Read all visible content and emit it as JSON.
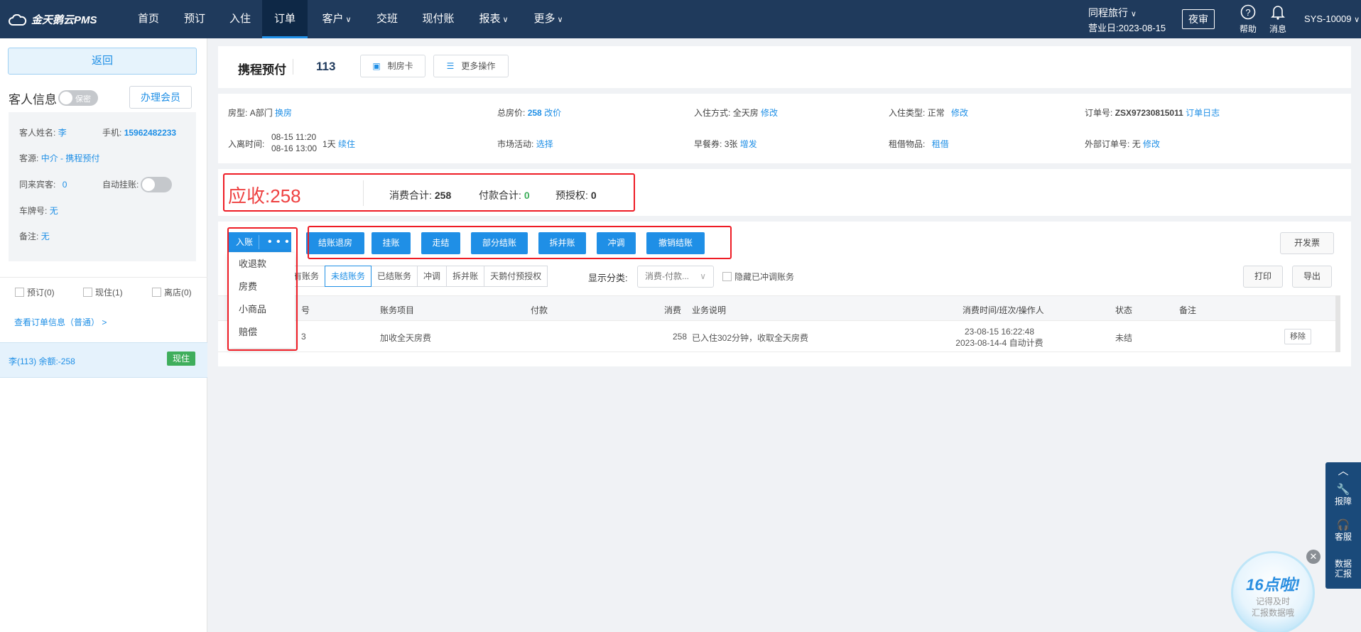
{
  "nav": {
    "logo": "金天鹅云PMS",
    "items": [
      "首页",
      "预订",
      "入住",
      "订单",
      "客户",
      "交班",
      "现付账",
      "报表",
      "更多"
    ],
    "active": "订单",
    "hotel": "同程旅行",
    "business_date_label": "营业日:",
    "business_date": "2023-08-15",
    "night_audit": "夜审",
    "help": "帮助",
    "messages": "消息",
    "user": "SYS-10009"
  },
  "left": {
    "back": "返回",
    "guest_title": "客人信息",
    "privacy_toggle": "保密",
    "member_button": "办理会员",
    "guest_name_label": "客人姓名:",
    "guest_name": "李",
    "phone_label": "手机:",
    "phone": "15962482233",
    "source_label": "客源:",
    "source": "中介",
    "source_detail": "- 携程预付",
    "companions_label": "同来宾客:",
    "companions": "0",
    "auto_hang_label": "自动挂账:",
    "plate_label": "车牌号:",
    "plate": "无",
    "remark_label": "备注:",
    "remark": "无",
    "checks": [
      "预订(0)",
      "现住(1)",
      "离店(0)"
    ],
    "order_info_link": "查看订单信息（普通） >",
    "room_row": "李(113)  余额:-258",
    "room_status": "现住"
  },
  "header": {
    "order_type": "携程预付",
    "room_no": "113",
    "make_card": "制房卡",
    "more_ops": "更多操作"
  },
  "details": {
    "room_type_label": "房型:",
    "room_type": "A部门",
    "change_room": "换房",
    "total_price_label": "总房价:",
    "total_price": "258",
    "change_price": "改价",
    "checkin_mode_label": "入住方式:",
    "checkin_mode": "全天房",
    "modify": "修改",
    "checkin_type_label": "入住类型:",
    "checkin_type": "正常",
    "order_no_label": "订单号:",
    "order_no": "ZSX97230815011",
    "order_log": "订单日志",
    "stay_label": "入离时间:",
    "arrive": "08-15 11:20",
    "depart": "08-16 13:00",
    "nights": "1天",
    "extend": "续住",
    "market_label": "市场活动:",
    "market": "选择",
    "breakfast_label": "早餐券:",
    "breakfast": "3张",
    "breakfast_add": "增发",
    "rental_label": "租借物品:",
    "rental": "租借",
    "ext_order_label": "外部订单号:",
    "ext_order": "无",
    "ext_modify": "修改"
  },
  "summary": {
    "due_label": "应收:",
    "due": "258",
    "consume_label": "消费合计:",
    "consume": "258",
    "payment_label": "付款合计:",
    "payment": "0",
    "preauth_label": "预授权:",
    "preauth": "0"
  },
  "billing": {
    "post": "入账",
    "more": "• • •",
    "actions": [
      "结账退房",
      "挂账",
      "走结",
      "部分结账",
      "拆并账",
      "冲调",
      "撤销结账"
    ],
    "invoice": "开发票",
    "filters": [
      "有账务",
      "未结账务",
      "已结账务",
      "冲调",
      "拆并账",
      "天鹅付预授权"
    ],
    "filter_active": "未结账务",
    "display_label": "显示分类:",
    "display_value": "消费-付款...",
    "hide_offset": "隐藏已冲调账务",
    "print": "打印",
    "export": "导出",
    "columns": [
      "号",
      "账务项目",
      "付款",
      "消费",
      "业务说明",
      "消费时间/班次/操作人",
      "状态",
      "备注"
    ],
    "rows": [
      {
        "no": "3",
        "item": "加收全天房费",
        "payment": "",
        "consume": "258",
        "desc": "已入住302分钟，收取全天房费",
        "time": "23-08-15 16:22:48",
        "shift": "2023-08-14-4 自动计费",
        "status": "未结",
        "remark": "",
        "action": "移除"
      }
    ],
    "dropdown": [
      "收退款",
      "房费",
      "小商品",
      "赔偿"
    ]
  },
  "float": {
    "report": "报障",
    "service": "客服",
    "data_line1": "数据",
    "data_line2": "汇报"
  },
  "promo": {
    "title": "16点啦!",
    "line1": "记得及时",
    "line2": "汇报数据哦"
  }
}
